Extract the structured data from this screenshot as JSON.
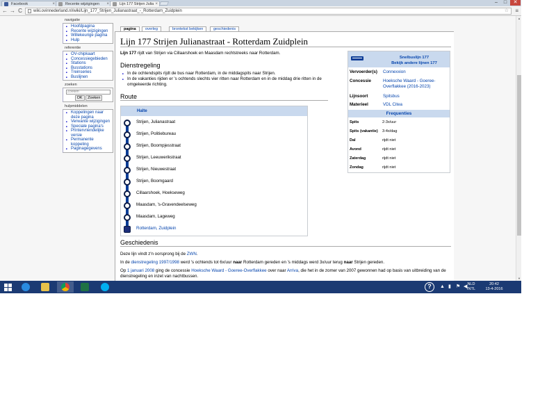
{
  "browser": {
    "tabs": [
      {
        "title": "Facebook",
        "color": "#3b5998"
      },
      {
        "title": "Recente wijzigingen",
        "color": "#888888"
      },
      {
        "title": "Lijn 177 Strijen Julia",
        "color": "#888888"
      }
    ],
    "url": "wiki.ovinnederland.nl/wiki/Lijn_177_Strijen_Julianastraat_-_Rotterdam_Zuidplein",
    "tab_close": "×",
    "back": "←",
    "forward": "→",
    "reload": "C",
    "star": "☆",
    "menu": "≡",
    "minimize": "–",
    "maximize": "□",
    "close": "✕"
  },
  "sidebar": {
    "navigatie": {
      "title": "navigatie",
      "items": [
        "Hoofdpagina",
        "Recente wijzigingen",
        "Willekeurige pagina",
        "Hulp"
      ]
    },
    "referentie": {
      "title": "referentie",
      "items": [
        "OV-chipkaart",
        "Concessiegebieden",
        "Stations",
        "Busstations",
        "Treinseries",
        "Buslijnen"
      ]
    },
    "zoeken": {
      "title": "zoeken",
      "placeholder": "Zoeken",
      "ok": "OK",
      "search": "Zoeken"
    },
    "hulpmiddelen": {
      "title": "hulpmiddelen",
      "items": [
        "Koppelingen naar deze pagina",
        "Verwante wijzigingen",
        "Speciale pagina's",
        "Printervriendelijke versie",
        "Permanente koppeling",
        "Paginagegevens"
      ]
    }
  },
  "page_tabs": [
    "pagina",
    "overleg",
    "brontekst bekijken",
    "geschiedenis"
  ],
  "article": {
    "title": "Lijn 177 Strijen Julianastraat - Rotterdam Zuidplein",
    "intro_bold": "Lijn 177",
    "intro_rest": " rijdt van Strijen via Cillaarshoek en Maasdam rechtstreeks naar Rotterdam.",
    "dienstregeling_heading": "Dienstregeling",
    "dienst_items": [
      "In de ochtendspits rijdt de bus naar Rotterdam, in de middagspits naar Strijen.",
      "In de vakanties rijden er 's ochtends slechts vier ritten naar Rotterdam en in de middag drie ritten in de omgekeerde richting."
    ],
    "route_heading": "Route",
    "route_col": "Halte",
    "stops": [
      "Strijen, Julianastraat",
      "Strijen, Politiebureau",
      "Strijen, Boompjesstraat",
      "Strijen, Leeuwerikstraat",
      "Strijen, Nieuwestraat",
      "Strijen, Boomgaard",
      "Cillaarshoek, Hoekseweg",
      "Maasdam, 's-Gravendeelseweg",
      "Maasdam, Lageweg",
      "Rotterdam, Zuidplein"
    ],
    "geschiedenis_heading": "Geschiedenis",
    "g1_pre": "Deze lijn vindt z'n oorsprong bij de ",
    "g1_link": "ZWN",
    "g1_post": ".",
    "g2_pre": "In de ",
    "g2_link": "dienstregeling 1997/1998",
    "g2_mid1": " werd 's ochtends tot 6x/uur ",
    "g2_b1": "naar",
    "g2_mid2": " Rotterdam gereden en 's middags werd 3x/uur terug ",
    "g2_b2": "naar",
    "g2_post": " Strijen gereden.",
    "g3_pre": "Op ",
    "g3_link1": "1 januari 2008",
    "g3_mid1": " ging de concessie ",
    "g3_link2": "Hoeksche Waard - Goeree-Overflakkee",
    "g3_mid2": " over naar ",
    "g3_link3": "Arriva",
    "g3_post": ", die het in de zomer van 2007 gewonnen had op basis van uitbreiding van de",
    "g3_line2": "dienstregeling en inzet van nachtbussen."
  },
  "infobox": {
    "title": "Snelbuslijn 177",
    "subtitle": "Bekijk andere lijnen 177",
    "rows": [
      {
        "k": "Vervoerder(s)",
        "v": "Connexxion"
      },
      {
        "k": "Concessie",
        "v": "Hoeksche Waard - Goeree-",
        "v2": "Overflakkee (2016-2023)"
      },
      {
        "k": "Lijnsoort",
        "v": "Spitsbus"
      },
      {
        "k": "Materieel",
        "v": "VDL Citea"
      }
    ],
    "freq_heading": "Frequenties",
    "freq": [
      {
        "k": "Spits",
        "v": "2-3x/uur"
      },
      {
        "k": "Spits (vakantie)",
        "v": "3-4x/dag"
      },
      {
        "k": "Dal",
        "v": "rijdt niet"
      },
      {
        "k": "Avond",
        "v": "rijdt niet"
      },
      {
        "k": "Zaterdag",
        "v": "rijdt niet"
      },
      {
        "k": "Zondag",
        "v": "rijdt niet"
      }
    ]
  },
  "taskbar": {
    "help": "?",
    "lang1": "NLD",
    "lang2": "INTL",
    "time": "20:42",
    "date": "13-4-2016",
    "apps": [
      "internet-explorer",
      "file-explorer",
      "chrome",
      "excel",
      "skype"
    ]
  }
}
